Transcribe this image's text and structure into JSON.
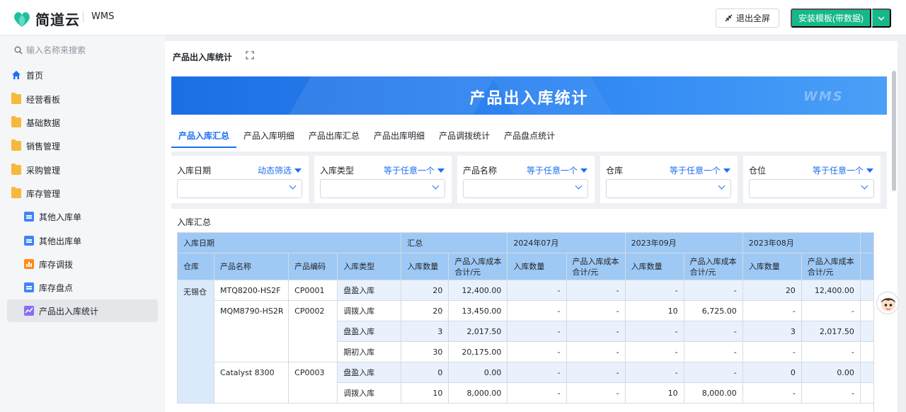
{
  "header": {
    "logo_text": "简道云",
    "app_name": "WMS",
    "exit_fullscreen_label": "退出全屏",
    "install_label": "安装模板(带数据)"
  },
  "sidebar": {
    "search_placeholder": "输入名称来搜索",
    "items": [
      {
        "label": "首页",
        "icon": "home-icon"
      },
      {
        "label": "经营看板",
        "icon": "folder-icon"
      },
      {
        "label": "基础数据",
        "icon": "folder-icon"
      },
      {
        "label": "销售管理",
        "icon": "folder-icon"
      },
      {
        "label": "采购管理",
        "icon": "folder-icon"
      },
      {
        "label": "库存管理",
        "icon": "folder-open-icon"
      },
      {
        "label": "其他入库单",
        "icon": "form-icon"
      },
      {
        "label": "其他出库单",
        "icon": "form-icon"
      },
      {
        "label": "库存调拨",
        "icon": "chart-icon"
      },
      {
        "label": "库存盘点",
        "icon": "form-icon"
      },
      {
        "label": "产品出入库统计",
        "icon": "dashboard-icon"
      }
    ]
  },
  "page": {
    "title": "产品出入库统计",
    "banner_title": "产品出入库统计",
    "banner_watermark": "WMS"
  },
  "tabs": [
    "产品入库汇总",
    "产品入库明细",
    "产品出库汇总",
    "产品出库明细",
    "产品调拨统计",
    "产品盘点统计"
  ],
  "filters": [
    {
      "label": "入库日期",
      "mode": "动态筛选"
    },
    {
      "label": "入库类型",
      "mode": "等于任意一个"
    },
    {
      "label": "产品名称",
      "mode": "等于任意一个"
    },
    {
      "label": "仓库",
      "mode": "等于任意一个"
    },
    {
      "label": "仓位",
      "mode": "等于任意一个"
    }
  ],
  "table": {
    "title": "入库汇总",
    "group_header_left": "入库日期",
    "groups": [
      "汇总",
      "2024年07月",
      "2023年09月",
      "2023年08月"
    ],
    "dim_headers": [
      "仓库",
      "产品名称",
      "产品编码",
      "入库类型"
    ],
    "measure_headers": [
      "入库数量",
      "产品入库成本合计/元"
    ],
    "warehouse": "无锡仓",
    "rows": [
      {
        "name": "MTQ8200-HS2F",
        "code": "CP0001",
        "type": "盘盈入库",
        "vals": [
          "20",
          "12,400.00",
          "-",
          "-",
          "-",
          "-",
          "20",
          "12,400.00"
        ]
      },
      {
        "name": "MQM8790-HS2R",
        "code": "CP0002",
        "type": "调拨入库",
        "vals": [
          "20",
          "13,450.00",
          "-",
          "-",
          "10",
          "6,725.00",
          "-",
          "-"
        ]
      },
      {
        "name": "",
        "code": "",
        "type": "盘盈入库",
        "vals": [
          "3",
          "2,017.50",
          "-",
          "-",
          "-",
          "-",
          "3",
          "2,017.50"
        ]
      },
      {
        "name": "",
        "code": "",
        "type": "期初入库",
        "vals": [
          "30",
          "20,175.00",
          "-",
          "-",
          "-",
          "-",
          "-",
          "-"
        ]
      },
      {
        "name": "Catalyst 8300",
        "code": "CP0003",
        "type": "盘盈入库",
        "vals": [
          "0",
          "0.00",
          "-",
          "-",
          "-",
          "-",
          "0",
          "0.00"
        ]
      },
      {
        "name": "",
        "code": "",
        "type": "调拨入库",
        "vals": [
          "10",
          "8,000.00",
          "-",
          "-",
          "10",
          "8,000.00",
          "-",
          "-"
        ]
      }
    ]
  }
}
